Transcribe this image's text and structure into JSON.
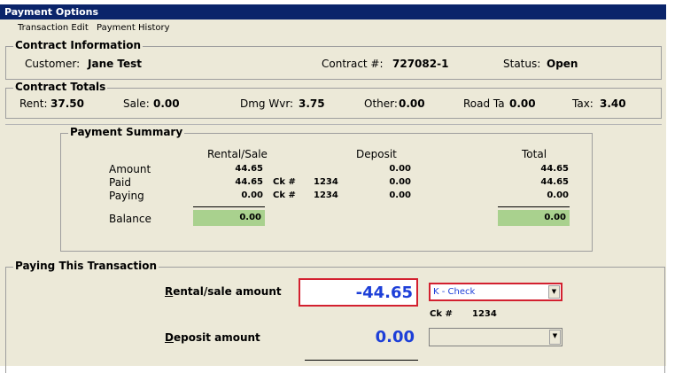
{
  "window": {
    "title": "Payment Options"
  },
  "menu": [
    "Transaction Edit",
    "Payment History"
  ],
  "contract_info": {
    "title": "Contract Information",
    "customer_label": "Customer:",
    "customer": "Jane Test",
    "contract_label": "Contract #:",
    "contract": "727082-1",
    "status_label": "Status:",
    "status": "Open"
  },
  "contract_totals": {
    "title": "Contract Totals",
    "rent_label": "Rent:",
    "rent": "37.50",
    "sale_label": "Sale:",
    "sale": "0.00",
    "dmg_label": "Dmg Wvr:",
    "dmg": "3.75",
    "other_label": "Other:",
    "other": "0.00",
    "road_label": "Road Ta",
    "road": "0.00",
    "tax_label": "Tax:",
    "tax": "3.40"
  },
  "payment_summary": {
    "title": "Payment Summary",
    "headers": {
      "rental": "Rental/Sale",
      "deposit": "Deposit",
      "total": "Total"
    },
    "rows": {
      "amount": {
        "label": "Amount",
        "rental": "44.65",
        "deposit": "0.00",
        "total": "44.65"
      },
      "paid": {
        "label": "Paid",
        "rental": "44.65",
        "ck_label": "Ck #",
        "ck": "1234",
        "deposit": "0.00",
        "total": "44.65"
      },
      "paying": {
        "label": "Paying",
        "rental": "0.00",
        "ck_label": "Ck #",
        "ck": "1234",
        "deposit": "0.00",
        "total": "0.00"
      }
    },
    "balance": {
      "label": "Balance",
      "rental": "0.00",
      "total": "0.00"
    }
  },
  "paying_transaction": {
    "title": "Paying This Transaction",
    "rental_label_first": "R",
    "rental_label_rest": "ental/sale amount",
    "rental_amount": "-44.65",
    "payment_type": "K - Check",
    "ck_label": "Ck #",
    "ck": "1234",
    "deposit_label_first": "D",
    "deposit_label_rest": "eposit amount",
    "deposit_amount": "0.00"
  },
  "colors": {
    "accent_red": "#d3202f",
    "amount_blue": "#1d3fd8",
    "balance_green": "#a9d18e",
    "titlebar": "#0a246a"
  }
}
